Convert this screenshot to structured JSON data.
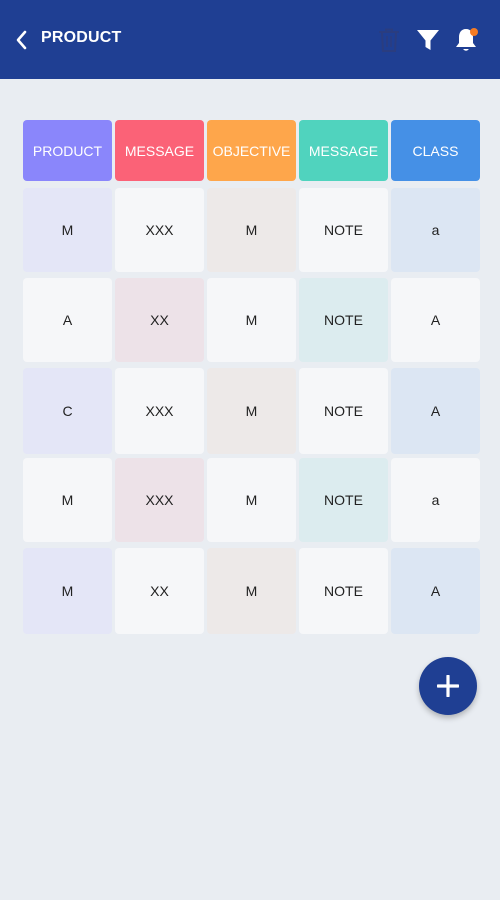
{
  "header": {
    "title": "PRODUCT",
    "back_icon": "chevron-left-icon",
    "actions": [
      "trash-icon",
      "filter-icon",
      "bell-icon"
    ],
    "notification_dot_color": "#f57c24",
    "background_color": "#1f3f93"
  },
  "table": {
    "columns": [
      {
        "label": "PRODUCT",
        "color": "#8a86fb"
      },
      {
        "label": "MESSAGE",
        "color": "#fb6277"
      },
      {
        "label": "OBJECTIVE",
        "color": "#fea64b"
      },
      {
        "label": "MESSAGE",
        "color": "#50d3be"
      },
      {
        "label": "CLASS",
        "color": "#4590e6"
      }
    ],
    "rows": [
      [
        "M",
        "XXX",
        "M",
        "NOTE",
        "a"
      ],
      [
        "A",
        "XX",
        "M",
        "NOTE",
        "A"
      ],
      [
        "C",
        "XXX",
        "M",
        "NOTE",
        "A"
      ],
      [
        "M",
        "XXX",
        "M",
        "NOTE",
        "a"
      ],
      [
        "M",
        "XX",
        "M",
        "NOTE",
        "A"
      ]
    ]
  },
  "fab": {
    "icon": "plus-icon"
  }
}
